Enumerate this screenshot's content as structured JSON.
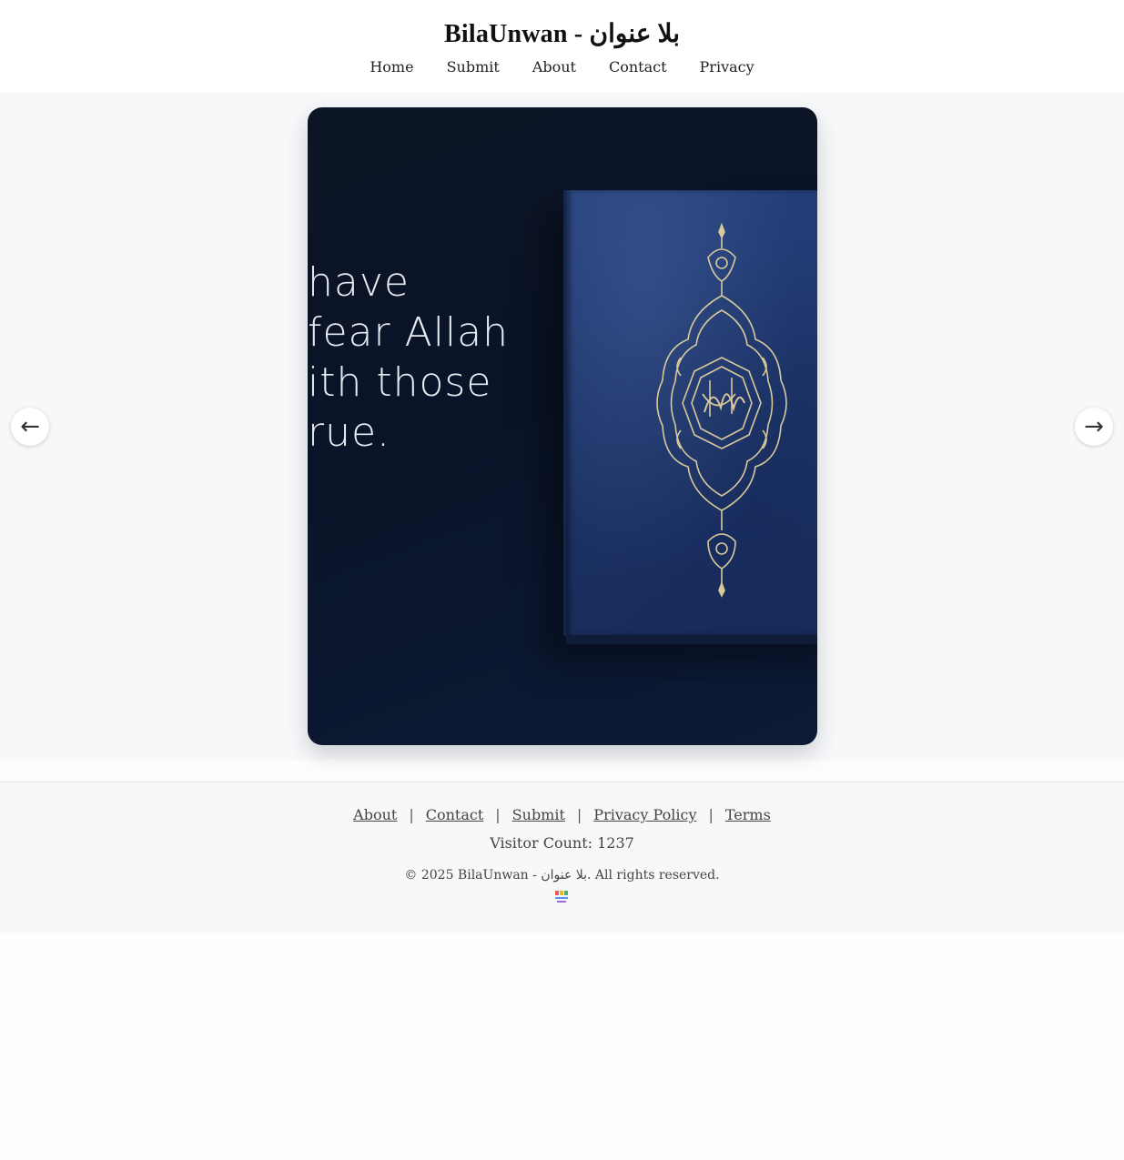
{
  "header": {
    "title": "BilaUnwan - بلا عنوان",
    "nav": [
      {
        "label": "Home"
      },
      {
        "label": "Submit"
      },
      {
        "label": "About"
      },
      {
        "label": "Contact"
      },
      {
        "label": "Privacy"
      }
    ]
  },
  "slider": {
    "quote_text": "have\nfear Allah\nith those\nrue.",
    "prev_icon": "←",
    "next_icon": "→",
    "colors": {
      "card_bg": "#0c1526",
      "book_blue": "#1d3468",
      "ornament_gold": "#d8c99a"
    }
  },
  "footer": {
    "links": [
      {
        "label": "About"
      },
      {
        "label": "Contact"
      },
      {
        "label": "Submit"
      },
      {
        "label": "Privacy Policy"
      },
      {
        "label": "Terms"
      }
    ],
    "separator": "|",
    "visitor_count": "Visitor Count: 1237",
    "copyright": "© 2025 BilaUnwan - بلا عنوان. All rights reserved."
  }
}
